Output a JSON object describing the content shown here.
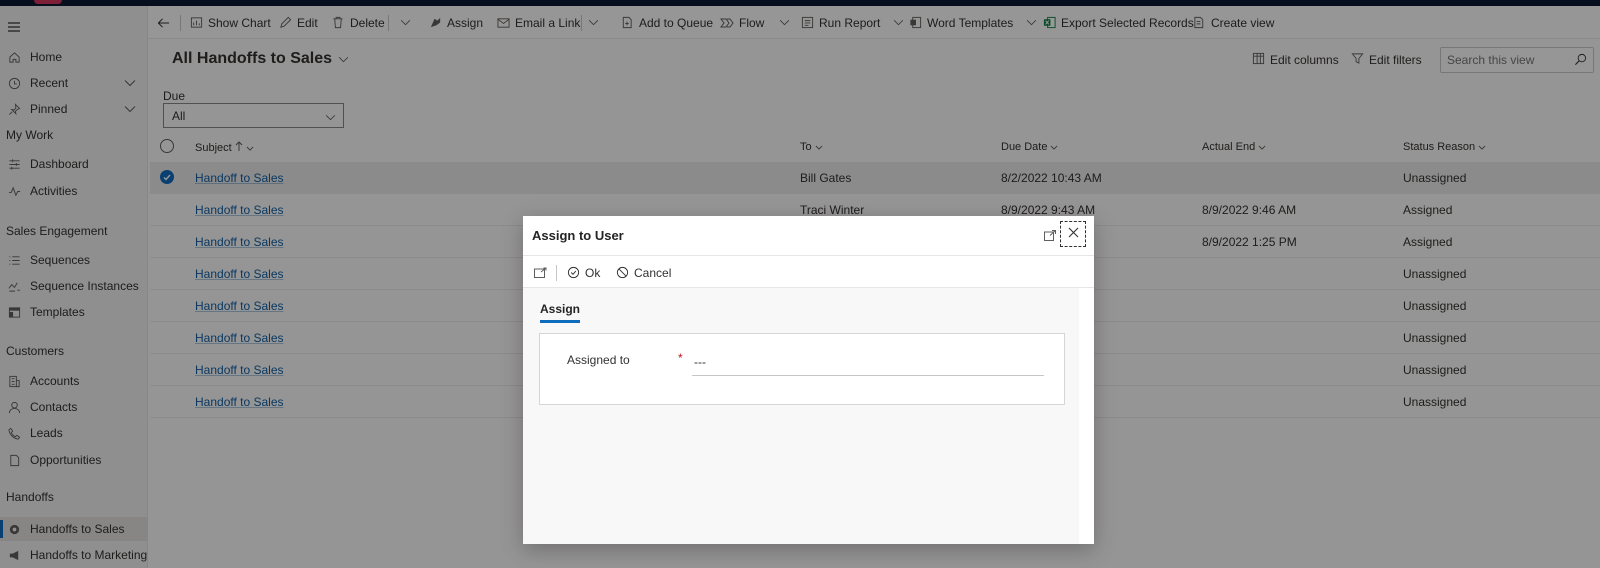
{
  "sidebar": {
    "items": [
      {
        "label": "Home",
        "icon": "home-icon"
      },
      {
        "label": "Recent",
        "icon": "clock-icon"
      },
      {
        "label": "Pinned",
        "icon": "pin-icon"
      }
    ],
    "groups": [
      {
        "title": "My Work",
        "items": [
          {
            "label": "Dashboard",
            "icon": "dashboard-icon"
          },
          {
            "label": "Activities",
            "icon": "activity-icon"
          }
        ]
      },
      {
        "title": "Sales Engagement",
        "items": [
          {
            "label": "Sequences",
            "icon": "list-icon"
          },
          {
            "label": "Sequence Instances",
            "icon": "sequence-instance-icon"
          },
          {
            "label": "Templates",
            "icon": "template-icon"
          }
        ]
      },
      {
        "title": "Customers",
        "items": [
          {
            "label": "Accounts",
            "icon": "building-icon"
          },
          {
            "label": "Contacts",
            "icon": "person-icon"
          },
          {
            "label": "Leads",
            "icon": "phone-icon"
          },
          {
            "label": "Opportunities",
            "icon": "document-icon"
          }
        ]
      },
      {
        "title": "Handoffs",
        "items": [
          {
            "label": "Handoffs to Sales",
            "icon": "handoff-icon",
            "active": true
          },
          {
            "label": "Handoffs to Marketing",
            "icon": "megaphone-icon"
          }
        ]
      }
    ]
  },
  "commands": {
    "show_chart": "Show Chart",
    "edit": "Edit",
    "delete": "Delete",
    "assign": "Assign",
    "email_link": "Email a Link",
    "add_to_queue": "Add to Queue",
    "flow": "Flow",
    "run_report": "Run Report",
    "word_templates": "Word Templates",
    "export": "Export Selected Records",
    "create_view": "Create view"
  },
  "view": {
    "title": "All Handoffs to Sales",
    "edit_columns": "Edit columns",
    "edit_filters": "Edit filters",
    "search_placeholder": "Search this view",
    "filter_label": "Due",
    "filter_value": "All"
  },
  "grid": {
    "columns": [
      "Subject",
      "To",
      "Due Date",
      "Actual End",
      "Status Reason"
    ],
    "rows": [
      {
        "subject": "Handoff to Sales",
        "to": "Bill Gates",
        "due": "8/2/2022 10:43 AM",
        "actual_end": "",
        "status": "Unassigned",
        "selected": true
      },
      {
        "subject": "Handoff to Sales",
        "to": "Traci Winter",
        "due": "8/9/2022 9:43 AM",
        "actual_end": "8/9/2022 9:46 AM",
        "status": "Assigned"
      },
      {
        "subject": "Handoff to Sales",
        "to": "",
        "due": "",
        "actual_end": "8/9/2022 1:25 PM",
        "status": "Assigned"
      },
      {
        "subject": "Handoff to Sales",
        "to": "",
        "due": "",
        "actual_end": "",
        "status": "Unassigned"
      },
      {
        "subject": "Handoff to Sales",
        "to": "",
        "due": "",
        "actual_end": "",
        "status": "Unassigned"
      },
      {
        "subject": "Handoff to Sales",
        "to": "",
        "due": "",
        "actual_end": "",
        "status": "Unassigned"
      },
      {
        "subject": "Handoff to Sales",
        "to": "",
        "due": "",
        "actual_end": "",
        "status": "Unassigned"
      },
      {
        "subject": "Handoff to Sales",
        "to": "",
        "due": "",
        "actual_end": "",
        "status": "Unassigned"
      }
    ]
  },
  "dialog": {
    "title": "Assign to User",
    "ok": "Ok",
    "cancel": "Cancel",
    "tab": "Assign",
    "field_label": "Assigned to",
    "required_mark": "*",
    "field_value": "---"
  },
  "colors": {
    "accent": "#0f6cbd",
    "link": "#115ea3",
    "required": "#c50f1f",
    "excel_green": "#107c41"
  }
}
